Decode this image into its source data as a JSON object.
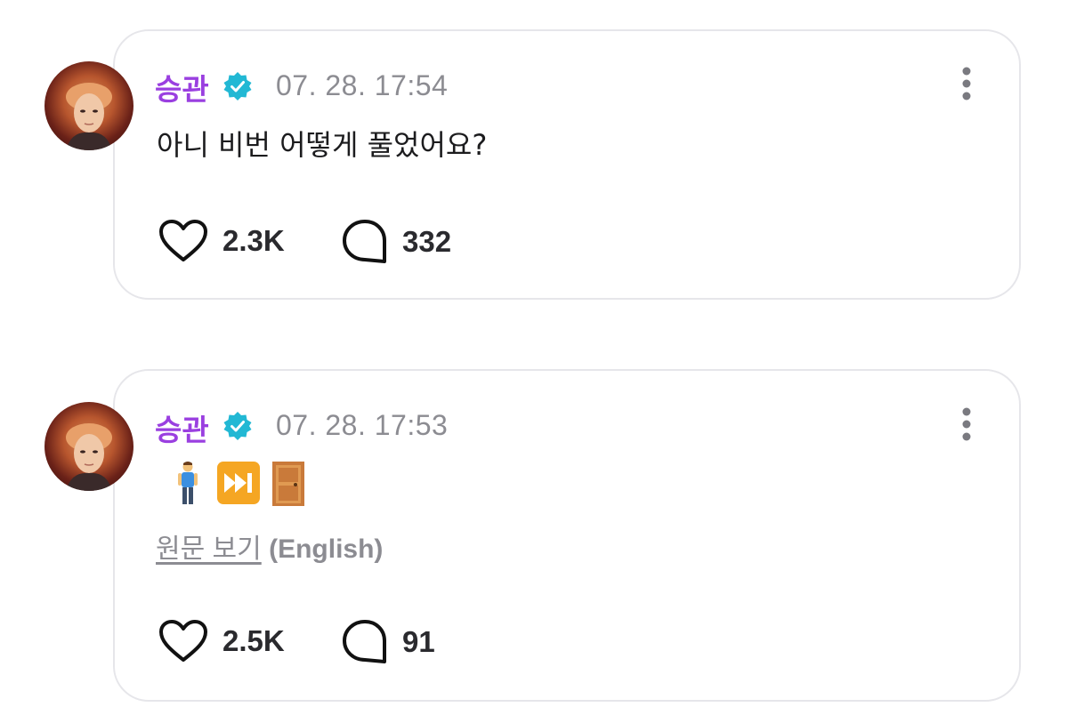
{
  "colors": {
    "username": "#9a3fe0",
    "verified_badge": "#22b8d4",
    "timestamp": "#8c8c92",
    "card_border": "#e6e6ea"
  },
  "posts": [
    {
      "username": "승관",
      "timestamp": "07. 28. 17:54",
      "text": "아니 비번 어떻게 풀었어요?",
      "likes": "2.3K",
      "comments": "332",
      "icons": [
        "avatar",
        "verified-badge-icon",
        "more-vertical-icon",
        "heart-icon",
        "comment-bubble-icon"
      ]
    },
    {
      "username": "승관",
      "timestamp": "07. 28. 17:53",
      "emojis": [
        "man-standing-emoji",
        "fast-forward-emoji",
        "door-emoji"
      ],
      "translate_link": "원문 보기",
      "translate_lang": "(English)",
      "likes": "2.5K",
      "comments": "91",
      "icons": [
        "avatar",
        "verified-badge-icon",
        "more-vertical-icon",
        "heart-icon",
        "comment-bubble-icon"
      ]
    }
  ]
}
